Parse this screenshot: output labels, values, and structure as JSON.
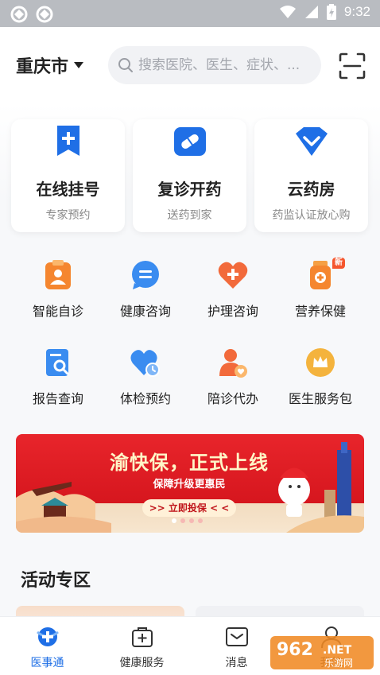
{
  "status_bar": {
    "time": "9:32"
  },
  "header": {
    "city": "重庆市",
    "search_placeholder": "搜索医院、医生、症状、...",
    "scan_icon": "scan-icon"
  },
  "feature_cards": [
    {
      "title": "在线挂号",
      "subtitle": "专家预约",
      "icon": "plus-bookmark-icon"
    },
    {
      "title": "复诊开药",
      "subtitle": "送药到家",
      "icon": "pill-icon"
    },
    {
      "title": "云药房",
      "subtitle": "药监认证放心购",
      "icon": "diamond-icon"
    }
  ],
  "services": [
    {
      "label": "智能自诊",
      "icon": "doctor-clipboard-icon"
    },
    {
      "label": "健康咨询",
      "icon": "chat-bubble-icon"
    },
    {
      "label": "护理咨询",
      "icon": "heart-plus-icon"
    },
    {
      "label": "营养保健",
      "icon": "supplement-bottle-icon",
      "badge": "新"
    },
    {
      "label": "报告查询",
      "icon": "report-search-icon"
    },
    {
      "label": "体检预约",
      "icon": "heart-clock-icon"
    },
    {
      "label": "陪诊代办",
      "icon": "person-heart-icon"
    },
    {
      "label": "医生服务包",
      "icon": "crown-icon"
    }
  ],
  "banner": {
    "title": "渝快保，正式上线",
    "subtitle": "保障升级更惠民",
    "button": ">> 立即投保 < <",
    "slide_count": 4,
    "active_slide": 1,
    "bg_color": "#e01d24"
  },
  "activity_section": {
    "title": "活动专区"
  },
  "tab_bar": [
    {
      "label": "医事通",
      "icon": "medical-cross-icon",
      "active": true
    },
    {
      "label": "健康服务",
      "icon": "health-bag-icon",
      "active": false
    },
    {
      "label": "消息",
      "icon": "message-icon",
      "active": false
    },
    {
      "label": "我的",
      "icon": "user-icon",
      "active": false
    }
  ],
  "colors": {
    "primary": "#1f6fe6",
    "orange": "#f26a3b"
  },
  "watermark": {
    "logo_text": "962.NET",
    "site_name": "乐游网"
  }
}
